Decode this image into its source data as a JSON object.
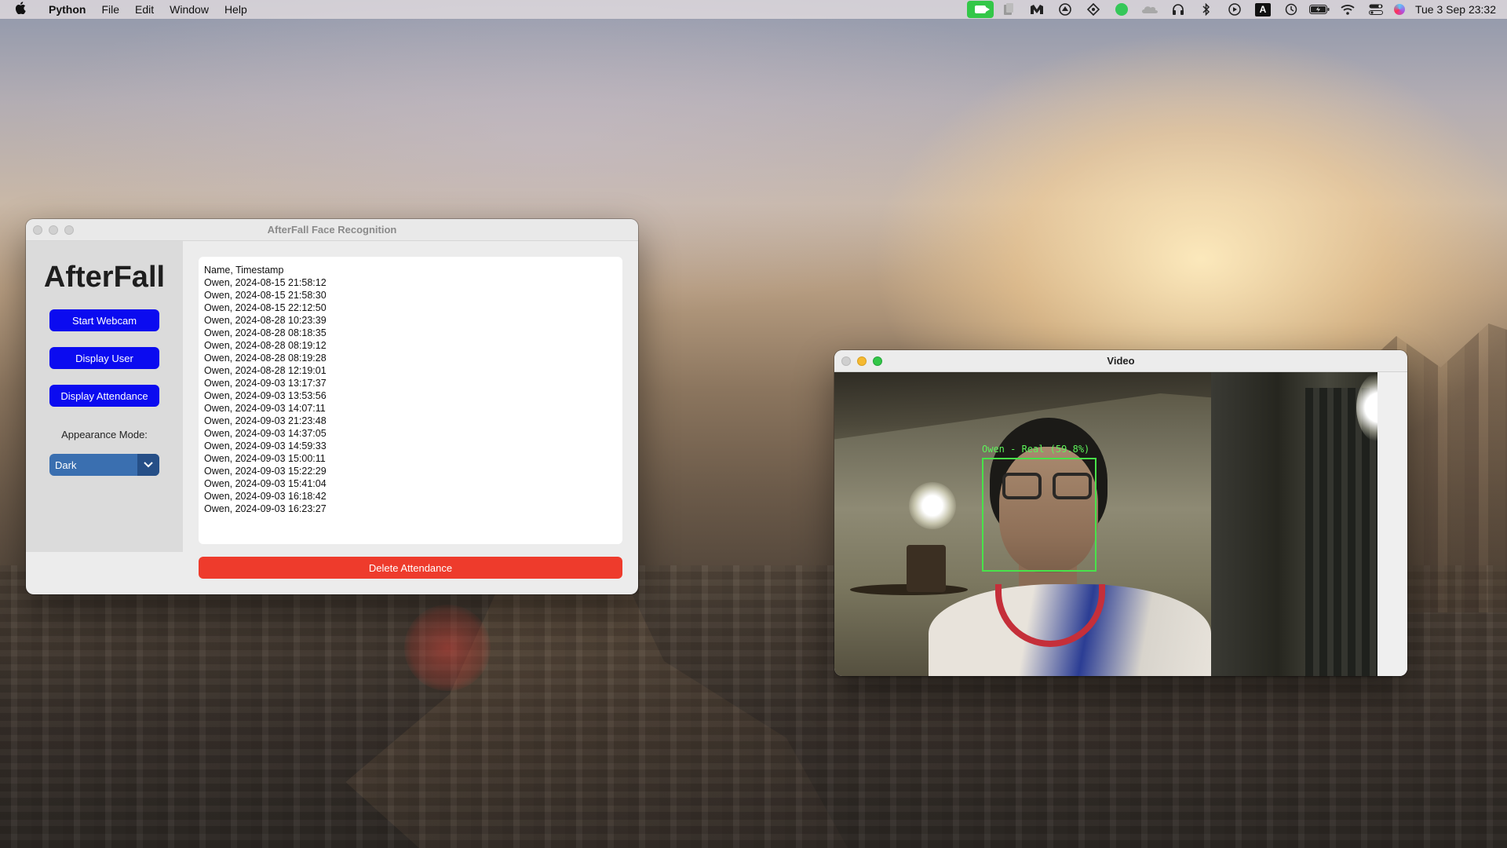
{
  "menubar": {
    "app_name": "Python",
    "menus": [
      "File",
      "Edit",
      "Window",
      "Help"
    ],
    "status_icons": [
      "facetime-icon",
      "clipboard-icon",
      "m-icon",
      "drive-icon",
      "dropzone-icon",
      "line-icon",
      "cloud-icon",
      "headphones-icon",
      "bluetooth-icon",
      "play-icon",
      "input-a-icon",
      "time-machine-icon",
      "battery-icon",
      "wifi-icon",
      "control-center-icon",
      "siri-icon"
    ],
    "input_letter": "A",
    "datetime": "Tue 3 Sep  23:32"
  },
  "afterfall_window": {
    "title": "AfterFall Face Recognition",
    "logo": "AfterFall",
    "buttons": {
      "start_webcam": "Start Webcam",
      "display_user": "Display User",
      "display_attendance": "Display Attendance",
      "delete_attendance": "Delete Attendance"
    },
    "appearance_label": "Appearance Mode:",
    "appearance_value": "Dark",
    "attendance_lines": [
      "Name, Timestamp",
      "Owen, 2024-08-15 21:58:12",
      "Owen, 2024-08-15 21:58:30",
      "Owen, 2024-08-15 22:12:50",
      "Owen, 2024-08-28 10:23:39",
      "Owen, 2024-08-28 08:18:35",
      "Owen, 2024-08-28 08:19:12",
      "Owen, 2024-08-28 08:19:28",
      "Owen, 2024-08-28 12:19:01",
      "Owen, 2024-09-03 13:17:37",
      "Owen, 2024-09-03 13:53:56",
      "Owen, 2024-09-03 14:07:11",
      "Owen, 2024-09-03 21:23:48",
      "Owen, 2024-09-03 14:37:05",
      "Owen, 2024-09-03 14:59:33",
      "Owen, 2024-09-03 15:00:11",
      "Owen, 2024-09-03 15:22:29",
      "Owen, 2024-09-03 15:41:04",
      "Owen, 2024-09-03 16:18:42",
      "Owen, 2024-09-03 16:23:27"
    ],
    "colors": {
      "primary_button": "#0b0bf0",
      "delete_button": "#ee3b2c",
      "dropdown": "#3a6fb0"
    }
  },
  "video_window": {
    "title": "Video",
    "detection_label": "Owen - Real (59.8%)",
    "colors": {
      "bbox": "#48e34a"
    }
  }
}
